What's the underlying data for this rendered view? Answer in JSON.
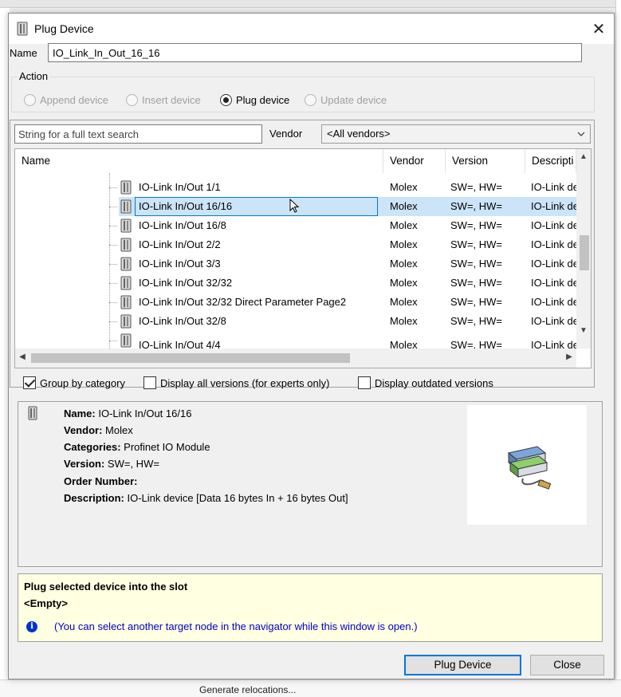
{
  "background": {
    "bottom_text": "Generate relocations..."
  },
  "dialog": {
    "title": "Plug Device",
    "close_glyph": "✕"
  },
  "name_field": {
    "label": "Name",
    "value": "IO_Link_In_Out_16_16"
  },
  "action": {
    "label": "Action",
    "options": [
      {
        "label": "Append device",
        "checked": false,
        "enabled": false
      },
      {
        "label": "Insert device",
        "checked": false,
        "enabled": false
      },
      {
        "label": "Plug device",
        "checked": true,
        "enabled": true
      },
      {
        "label": "Update device",
        "checked": false,
        "enabled": false
      }
    ]
  },
  "search": {
    "placeholder": "String for a full text search",
    "vendor_label": "Vendor",
    "vendor_value": "<All vendors>"
  },
  "device_table": {
    "columns": [
      "Name",
      "Vendor",
      "Version",
      "Descripti"
    ],
    "rows": [
      {
        "name": "IO-Link In/Out 1/1",
        "vendor": "Molex",
        "version": "SW=, HW=",
        "description": "IO-Link de"
      },
      {
        "name": "IO-Link In/Out 16/16",
        "vendor": "Molex",
        "version": "SW=, HW=",
        "description": "IO-Link de",
        "selected": true
      },
      {
        "name": "IO-Link In/Out 16/8",
        "vendor": "Molex",
        "version": "SW=, HW=",
        "description": "IO-Link de"
      },
      {
        "name": "IO-Link In/Out 2/2",
        "vendor": "Molex",
        "version": "SW=, HW=",
        "description": "IO-Link de"
      },
      {
        "name": "IO-Link In/Out 3/3",
        "vendor": "Molex",
        "version": "SW=, HW=",
        "description": "IO-Link de"
      },
      {
        "name": "IO-Link In/Out 32/32",
        "vendor": "Molex",
        "version": "SW=, HW=",
        "description": "IO-Link de"
      },
      {
        "name": "IO-Link In/Out 32/32 Direct Parameter Page2",
        "vendor": "Molex",
        "version": "SW=, HW=",
        "description": "IO-Link de"
      },
      {
        "name": "IO-Link In/Out 32/8",
        "vendor": "Molex",
        "version": "SW=, HW=",
        "description": "IO-Link de"
      },
      {
        "name": "IO-Link In/Out 4/4",
        "vendor": "Molex",
        "version": "SW=, HW=",
        "description": "IO-Link de"
      }
    ]
  },
  "options": {
    "group_by_category": {
      "label": "Group by category",
      "checked": true
    },
    "display_all_versions": {
      "label": "Display all versions (for experts only)",
      "checked": false
    },
    "display_outdated": {
      "label": "Display outdated versions",
      "checked": false
    }
  },
  "details": {
    "name_label": "Name:",
    "name_value": "IO-Link In/Out 16/16",
    "vendor_label": "Vendor:",
    "vendor_value": "Molex",
    "categories_label": "Categories:",
    "categories_value": "Profinet IO Module",
    "version_label": "Version:",
    "version_value": "SW=, HW=",
    "order_label": "Order Number:",
    "order_value": "",
    "description_label": "Description:",
    "description_value": "IO-Link device [Data 16 bytes In + 16 bytes Out]"
  },
  "hint": {
    "title": "Plug selected device into the slot",
    "slot": "<Empty>",
    "note": "(You can select another target node in the navigator while this window is open.)"
  },
  "buttons": {
    "plug_device": "Plug Device",
    "close": "Close"
  },
  "colors": {
    "selection": "#cce4f7",
    "selection_border": "#0078d7",
    "hint_background": "#ffffe1",
    "hint_text": "#0000cc"
  }
}
